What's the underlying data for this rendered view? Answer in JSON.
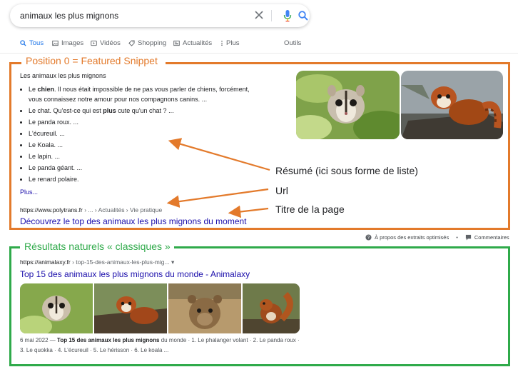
{
  "search": {
    "query": "animaux les plus mignons"
  },
  "tabs": [
    {
      "label": "Tous",
      "icon": "search-icon"
    },
    {
      "label": "Images",
      "icon": "image-icon"
    },
    {
      "label": "Vidéos",
      "icon": "video-icon"
    },
    {
      "label": "Shopping",
      "icon": "tag-icon"
    },
    {
      "label": "Actualités",
      "icon": "newspaper-icon"
    },
    {
      "label": "Plus",
      "icon": "more-vert-icon"
    },
    {
      "label": "Outils"
    }
  ],
  "featured": {
    "section_title": "Position 0 = Featured Snippet",
    "heading": "Les animaux les plus mignons",
    "list": {
      "item1_pre": "Le ",
      "item1_bold": "chien",
      "item1_post": ". Il nous était impossible de ne pas vous parler de chiens, forcément, vous connaissez notre amour pour nos compagnons canins. ...",
      "item2_pre": "Le chat. Qu'est-ce qui est ",
      "item2_bold": "plus",
      "item2_post": " cute qu'un chat ? ...",
      "item3": "Le panda roux. ...",
      "item4": "L'écureuil. ...",
      "item5": "Le Koala. ...",
      "item6": "Le lapin. ...",
      "item7": "Le panda géant. ...",
      "item8": "Le renard polaire."
    },
    "more": "Plus...",
    "url_site": "https://www.polytrans.fr",
    "url_crumbs": " › ... › Actualités › Vie pratique",
    "title": "Découvrez le top des animaux les plus mignons du moment",
    "annotations": {
      "summary": "Résumé (ici sous forme de liste)",
      "url": "Url",
      "page_title": "Titre de la page"
    },
    "footer": {
      "about": "À propos des extraits optimisés",
      "separator": "•",
      "feedback": "Commentaires"
    }
  },
  "organic": {
    "section_title": "Résultats naturels « classiques »",
    "url_site": "https://animalaxy.fr",
    "url_crumbs": " › top-15-des-animaux-les-plus-mig...",
    "title": "Top 15 des animaux les plus mignons du monde - Animalaxy",
    "desc_date": "6 mai 2022 — ",
    "desc_bold": "Top 15 des animaux les plus mignons",
    "desc_rest": " du monde · 1. Le phalanger volant · 2. Le panda roux · 3. Le quokka · 4. L'écureuil · 5. Le hérisson · 6. Le koala ..."
  },
  "colors": {
    "featured_accent": "#e37a2b",
    "organic_accent": "#2faa4a",
    "link": "#1a0dab",
    "active_tab": "#1a73e8"
  }
}
